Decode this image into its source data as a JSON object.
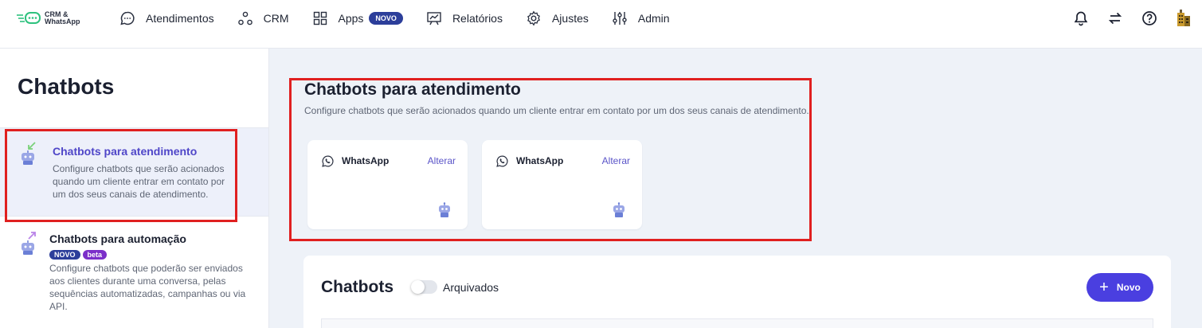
{
  "brand": {
    "logo_line1": "CRM &",
    "logo_line2": "WhatsApp"
  },
  "nav": {
    "items": [
      {
        "label": "Atendimentos",
        "icon": "chat-bubble-icon"
      },
      {
        "label": "CRM",
        "icon": "nodes-icon"
      },
      {
        "label": "Apps",
        "icon": "grid-icon",
        "badge": "NOVO"
      },
      {
        "label": "Relatórios",
        "icon": "chart-board-icon"
      },
      {
        "label": "Ajustes",
        "icon": "gear-icon"
      },
      {
        "label": "Admin",
        "icon": "sliders-icon"
      }
    ]
  },
  "sidebar": {
    "title": "Chatbots",
    "items": [
      {
        "title": "Chatbots para atendimento",
        "description": "Configure chatbots que serão acionados quando um cliente entrar em contato por um dos seus canais de atendimento."
      },
      {
        "title": "Chatbots para automação",
        "badges": [
          "NOVO",
          "beta"
        ],
        "description": "Configure chatbots que poderão ser enviados aos clientes durante uma conversa, pelas sequências automatizadas, campanhas ou via API."
      }
    ]
  },
  "main": {
    "title": "Chatbots para atendimento",
    "subtitle": "Configure chatbots que serão acionados quando um cliente entrar em contato por um dos seus canais de atendimento.",
    "channels": [
      {
        "name": "WhatsApp",
        "action": "Alterar"
      },
      {
        "name": "WhatsApp",
        "action": "Alterar"
      }
    ]
  },
  "list": {
    "title": "Chatbots",
    "toggle_label": "Arquivados",
    "new_button": "Novo"
  },
  "colors": {
    "accent": "#4a3fe0",
    "link": "#5a54c8",
    "highlight": "#e02020",
    "badge_novo": "#2c3e9a",
    "badge_beta": "#7b2fc9"
  }
}
